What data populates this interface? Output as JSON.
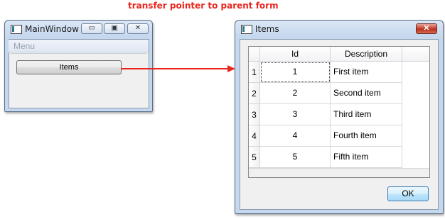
{
  "annotation": "transfer pointer to parent form",
  "main_window": {
    "title": "MainWindow",
    "menu": "Menu",
    "button_label": "Items",
    "controls": {
      "minimize": "▭",
      "restore": "▣",
      "close": "✕"
    }
  },
  "items_dialog": {
    "title": "Items",
    "close": "✕",
    "columns": [
      "Id",
      "Description"
    ],
    "rows": [
      {
        "row": "1",
        "id": "1",
        "description": "First item"
      },
      {
        "row": "2",
        "id": "2",
        "description": "Second item"
      },
      {
        "row": "3",
        "id": "3",
        "description": "Third item"
      },
      {
        "row": "4",
        "id": "4",
        "description": "Fourth item"
      },
      {
        "row": "5",
        "id": "5",
        "description": "Fifth item"
      }
    ],
    "ok_label": "OK"
  },
  "colors": {
    "annotation": "#e8261d",
    "arrow": "#e8261d"
  }
}
